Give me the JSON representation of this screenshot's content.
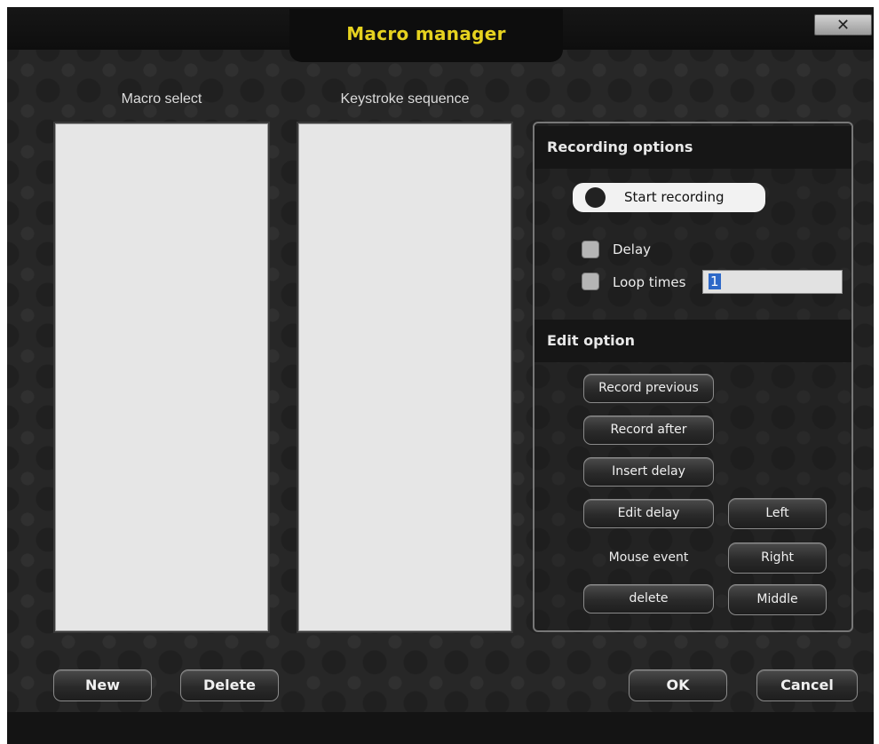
{
  "window": {
    "title": "Macro manager",
    "close_label": "✕"
  },
  "columns": {
    "macro_select": "Macro select",
    "keystroke_sequence": "Keystroke sequence"
  },
  "recording": {
    "header": "Recording options",
    "start_label": "Start recording",
    "delay_label": "Delay",
    "loop_label": "Loop times",
    "loop_value": "1"
  },
  "edit": {
    "header": "Edit option",
    "record_previous": "Record previous",
    "record_after": "Record after",
    "insert_delay": "Insert delay",
    "edit_delay": "Edit delay",
    "mouse_event_label": "Mouse event",
    "delete": "delete",
    "left": "Left",
    "right": "Right",
    "middle": "Middle"
  },
  "footer": {
    "new": "New",
    "delete": "Delete",
    "ok": "OK",
    "cancel": "Cancel"
  },
  "colors": {
    "title": "#e6d21f",
    "background": "#272727",
    "list_bg": "#e6e6e6",
    "selection": "#2e69c8"
  }
}
